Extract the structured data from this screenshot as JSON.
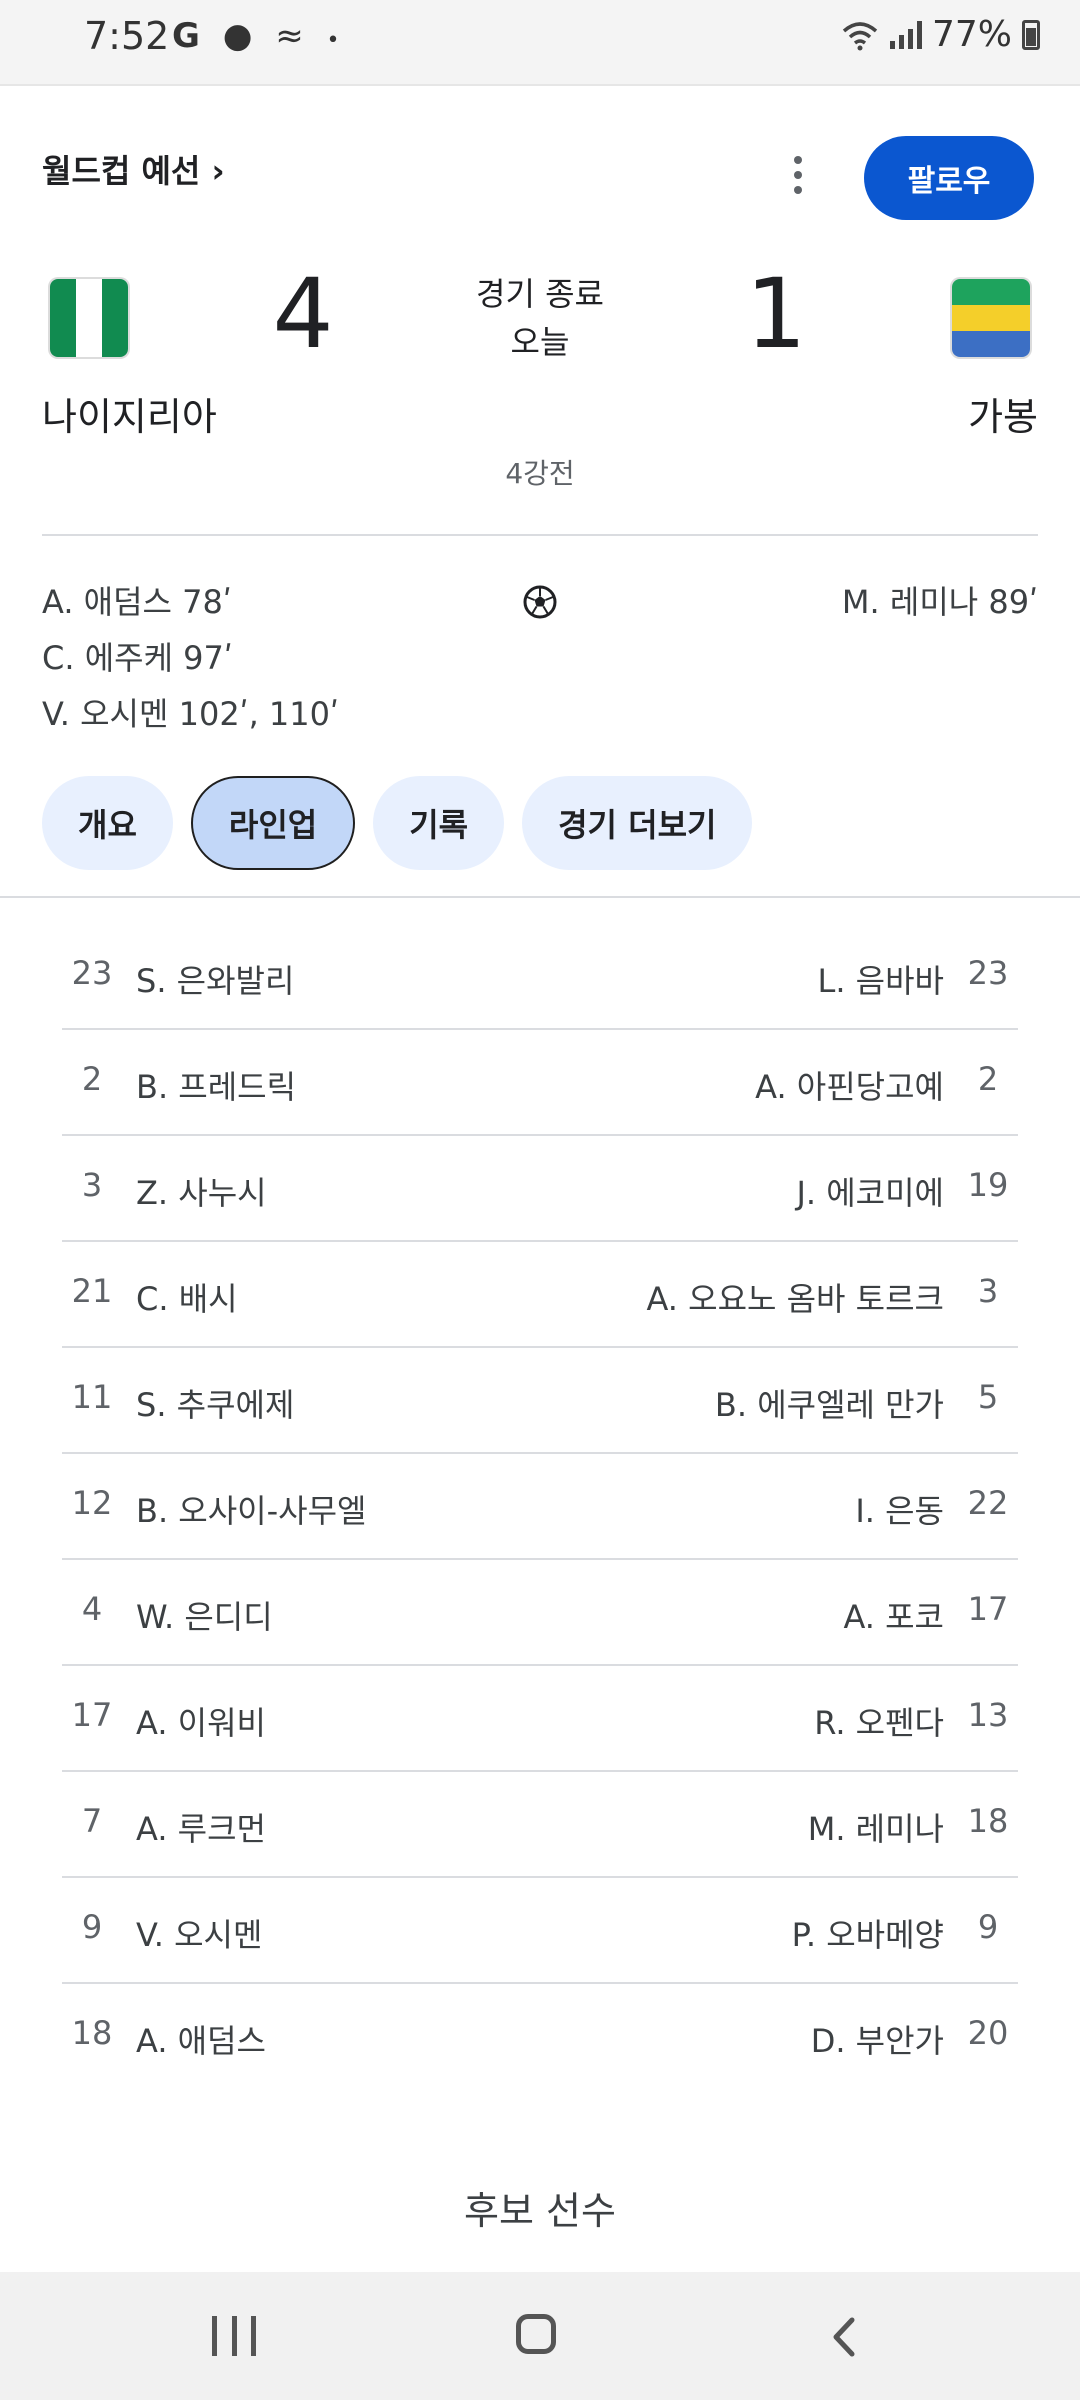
{
  "status_bar": {
    "time": "7:52",
    "left_icons": [
      "G",
      "●",
      "≈",
      "•"
    ],
    "battery": "77%",
    "icon_names": [
      "google-icon",
      "messenger-icon",
      "weather-icon",
      "dot-icon",
      "wifi-icon",
      "signal-icon",
      "battery-icon"
    ]
  },
  "header": {
    "competition": "월드컵 예선 ›",
    "follow_label": "팔로우"
  },
  "match": {
    "home": {
      "name": "나이지리아",
      "score": "4"
    },
    "away": {
      "name": "가봉",
      "score": "1"
    },
    "status_line1": "경기 종료",
    "status_line2": "오늘",
    "round": "4강전"
  },
  "scorers": {
    "home": [
      "A. 애덤스 78ʹ",
      "C. 에주케 97ʹ",
      "V. 오시멘 102ʹ, 110ʹ"
    ],
    "away": [
      "M. 레미나 89ʹ"
    ]
  },
  "tabs": [
    {
      "label": "개요",
      "active": false
    },
    {
      "label": "라인업",
      "active": true
    },
    {
      "label": "기록",
      "active": false
    },
    {
      "label": "경기 더보기",
      "active": false
    }
  ],
  "lineup": [
    {
      "home_num": "23",
      "home_name": "S. 은와발리",
      "away_name": "L. 음바바",
      "away_num": "23"
    },
    {
      "home_num": "2",
      "home_name": "B. 프레드릭",
      "away_name": "A. 아핀당고예",
      "away_num": "2"
    },
    {
      "home_num": "3",
      "home_name": "Z. 사누시",
      "away_name": "J. 에코미에",
      "away_num": "19"
    },
    {
      "home_num": "21",
      "home_name": "C. 배시",
      "away_name": "A. 오요노 옴바 토르크",
      "away_num": "3"
    },
    {
      "home_num": "11",
      "home_name": "S. 추쿠에제",
      "away_name": "B. 에쿠엘레 만가",
      "away_num": "5"
    },
    {
      "home_num": "12",
      "home_name": "B. 오사이-사무엘",
      "away_name": "I. 은동",
      "away_num": "22"
    },
    {
      "home_num": "4",
      "home_name": "W. 은디디",
      "away_name": "A. 포코",
      "away_num": "17"
    },
    {
      "home_num": "17",
      "home_name": "A. 이워비",
      "away_name": "R. 오펜다",
      "away_num": "13"
    },
    {
      "home_num": "7",
      "home_name": "A. 루크먼",
      "away_name": "M. 레미나",
      "away_num": "18"
    },
    {
      "home_num": "9",
      "home_name": "V. 오시멘",
      "away_name": "P. 오바메양",
      "away_num": "9"
    },
    {
      "home_num": "18",
      "home_name": "A. 애덤스",
      "away_name": "D. 부안가",
      "away_num": "20"
    }
  ],
  "subs_title": "후보 선수",
  "colors": {
    "accent": "#0b57d0",
    "tab_bg": "#e8f0fe",
    "tab_active_bg": "#c2d7f8",
    "divider": "#dadce0"
  }
}
